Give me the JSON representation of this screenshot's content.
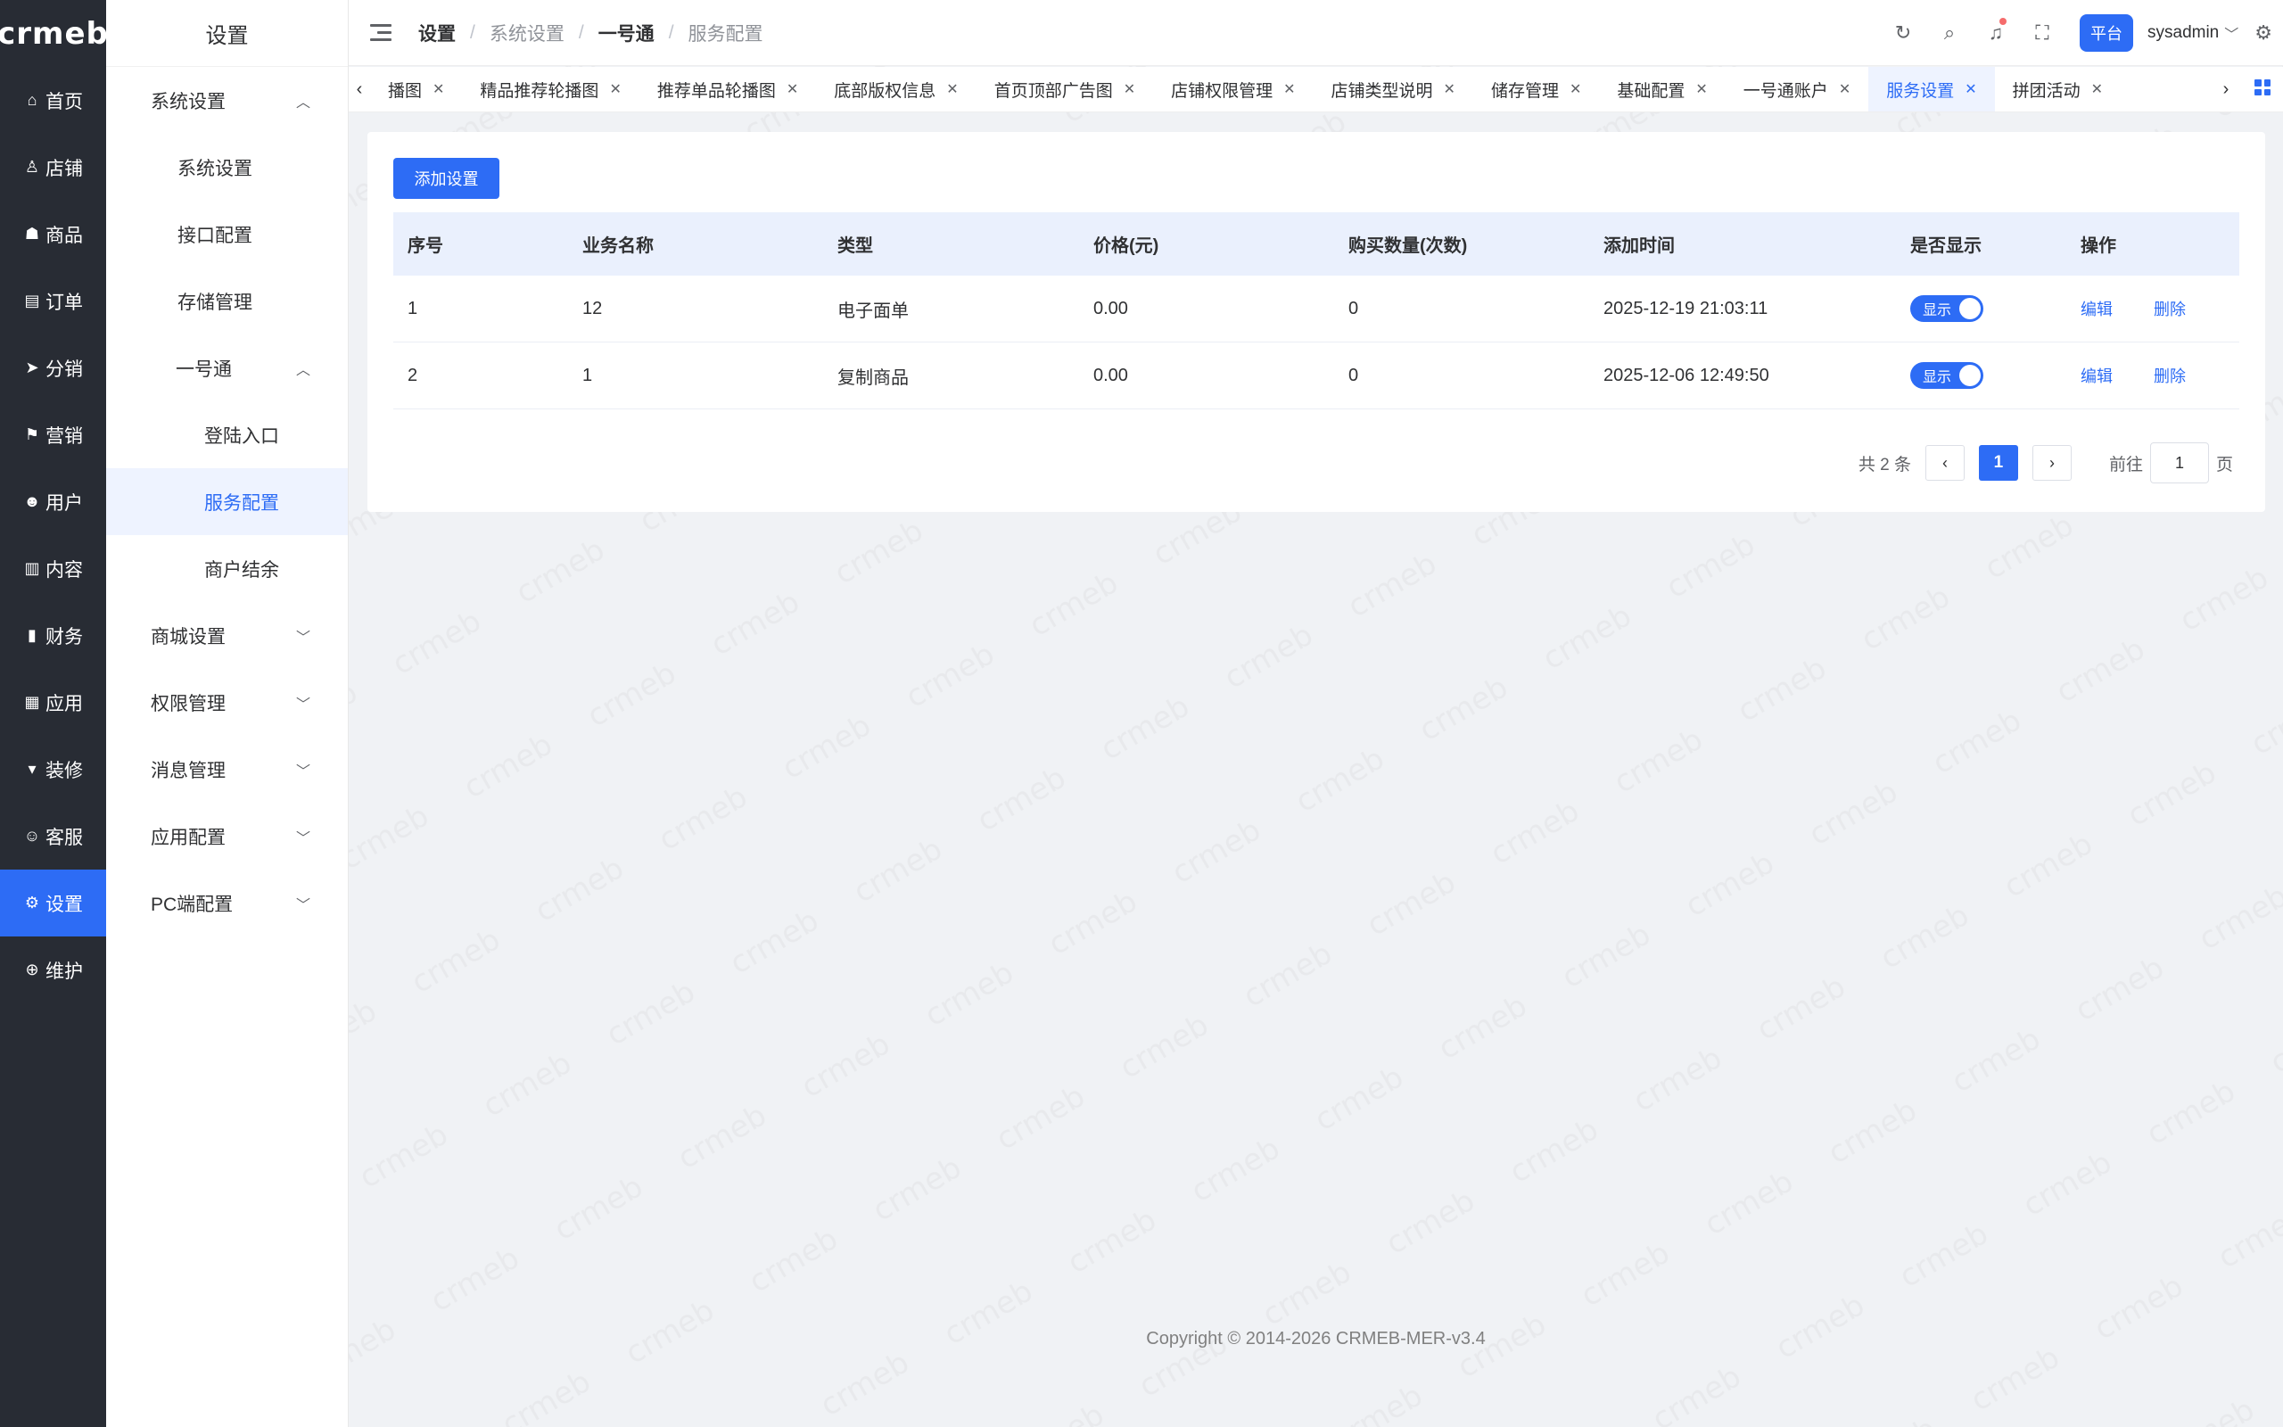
{
  "brand": {
    "logo": "crmeb"
  },
  "rail": [
    {
      "icon": "⌂",
      "label": "首页"
    },
    {
      "icon": "♙",
      "label": "店铺"
    },
    {
      "icon": "☗",
      "label": "商品"
    },
    {
      "icon": "▤",
      "label": "订单"
    },
    {
      "icon": "➤",
      "label": "分销"
    },
    {
      "icon": "⚑",
      "label": "营销"
    },
    {
      "icon": "☻",
      "label": "用户"
    },
    {
      "icon": "▥",
      "label": "内容"
    },
    {
      "icon": "▮",
      "label": "财务"
    },
    {
      "icon": "▦",
      "label": "应用"
    },
    {
      "icon": "▾",
      "label": "装修"
    },
    {
      "icon": "☺",
      "label": "客服"
    },
    {
      "icon": "⚙",
      "label": "设置"
    },
    {
      "icon": "⊕",
      "label": "维护"
    }
  ],
  "subnav": {
    "title": "设置",
    "system_group": "系统设置",
    "items": [
      "系统设置",
      "接口配置",
      "存储管理"
    ],
    "yihao_group": "一号通",
    "yihao_items": [
      "登陆入口",
      "服务配置",
      "商户结余"
    ],
    "groups": [
      "商城设置",
      "权限管理",
      "消息管理",
      "应用配置",
      "PC端配置"
    ]
  },
  "header": {
    "crumbs": [
      "设置",
      "系统设置",
      "一号通",
      "服务配置"
    ],
    "platform": "平台",
    "user": "sysadmin"
  },
  "tabs": [
    "播图",
    "精品推荐轮播图",
    "推荐单品轮播图",
    "底部版权信息",
    "首页顶部广告图",
    "店铺权限管理",
    "店铺类型说明",
    "储存管理",
    "基础配置",
    "一号通账户",
    "服务设置",
    "拼团活动"
  ],
  "toolbar": {
    "add_label": "添加设置"
  },
  "table": {
    "headers": [
      "序号",
      "业务名称",
      "类型",
      "价格(元)",
      "购买数量(次数)",
      "添加时间",
      "是否显示",
      "操作"
    ],
    "rows": [
      {
        "id": "1",
        "name": "12",
        "type": "电子面单",
        "price": "0.00",
        "count": "0",
        "time": "2025-12-19 21:03:11",
        "show": "显示",
        "edit": "编辑",
        "delete": "删除"
      },
      {
        "id": "2",
        "name": "1",
        "type": "复制商品",
        "price": "0.00",
        "count": "0",
        "time": "2025-12-06 12:49:50",
        "show": "显示",
        "edit": "编辑",
        "delete": "删除"
      }
    ]
  },
  "pagination": {
    "total": "共 2 条",
    "current": "1",
    "goto_prefix": "前往",
    "goto_value": "1",
    "goto_suffix": "页"
  },
  "footer": "Copyright © 2014-2026 CRMEB-MER-v3.4",
  "colors": {
    "accent": "#2d6cf5",
    "rail_bg": "#282c34"
  }
}
